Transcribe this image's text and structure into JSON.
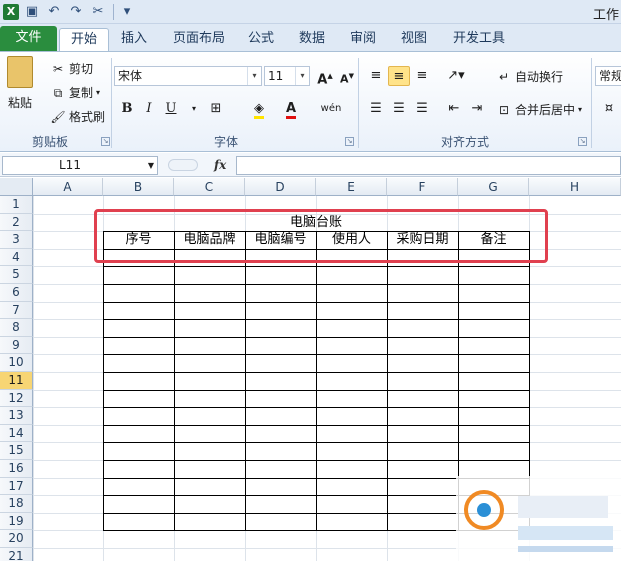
{
  "app": {
    "logo_text": "X",
    "window_title": "工作"
  },
  "ribbon_tabs": {
    "file": "文件",
    "home": "开始",
    "insert": "插入",
    "page_layout": "页面布局",
    "formulas": "公式",
    "data": "数据",
    "review": "审阅",
    "view": "视图",
    "developer": "开发工具"
  },
  "clipboard": {
    "paste": "粘贴",
    "cut": "剪切",
    "copy": "复制",
    "format_painter": "格式刷",
    "group_label": "剪贴板"
  },
  "font": {
    "name": "宋体",
    "size": "11",
    "bold": "B",
    "italic": "I",
    "underline": "U",
    "wen": "wén",
    "group_label": "字体"
  },
  "alignment": {
    "wrap_text": "自动换行",
    "merge_center": "合并后居中",
    "group_label": "对齐方式"
  },
  "number": {
    "format": "常规"
  },
  "formula_bar": {
    "name_box": "L11",
    "fx": "fx"
  },
  "sheet": {
    "columns": [
      "A",
      "B",
      "C",
      "D",
      "E",
      "F",
      "G",
      "H"
    ],
    "rows": [
      "1",
      "2",
      "3",
      "4",
      "5",
      "6",
      "7",
      "8",
      "9",
      "10",
      "11",
      "12",
      "13",
      "14",
      "15",
      "16",
      "17",
      "18",
      "19",
      "20",
      "21"
    ],
    "active_row": "11",
    "table_title": "电脑台账",
    "headers": [
      "序号",
      "电脑品牌",
      "电脑编号",
      "使用人",
      "采购日期",
      "备注"
    ]
  },
  "colors": {
    "file_tab": "#2a8d3e",
    "highlight_box": "#e0404f",
    "active_row": "#f7d574"
  }
}
